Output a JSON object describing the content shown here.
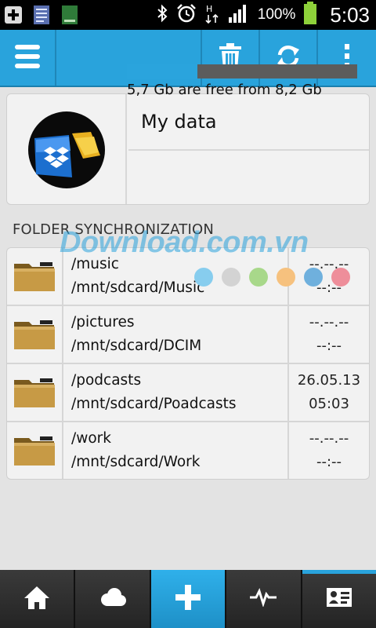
{
  "status_bar": {
    "battery_percent": "100%",
    "time": "5:03",
    "icons": [
      "add-icon",
      "document-icon",
      "book-icon",
      "bluetooth-icon",
      "alarm-icon",
      "hspa-signal-icon",
      "cell-signal-icon",
      "battery-icon"
    ]
  },
  "action_bar": {
    "buttons": [
      "menu-icon",
      "trash-icon",
      "refresh-icon",
      "overflow-icon"
    ],
    "accent_color": "#29a3dc"
  },
  "account": {
    "name": "My data",
    "storage_text": "5,7 Gb are free from 8,2 Gb",
    "used_fraction": 0.305,
    "service_icon": "dropbox-icon"
  },
  "section": {
    "title": "FOLDER SYNCHRONIZATION"
  },
  "folders": [
    {
      "name": "/music",
      "path": "/mnt/sdcard/Music",
      "date": "--.--.--",
      "time": "--:--"
    },
    {
      "name": "/pictures",
      "path": "/mnt/sdcard/DCIM",
      "date": "--.--.--",
      "time": "--:--"
    },
    {
      "name": "/podcasts",
      "path": "/mnt/sdcard/Poadcasts",
      "date": "26.05.13",
      "time": "05:03"
    },
    {
      "name": "/work",
      "path": "/mnt/sdcard/Work",
      "date": "--.--.--",
      "time": "--:--"
    }
  ],
  "watermark": {
    "text": "Download.com.vn",
    "dot_colors": [
      "#87cdee",
      "#d3d3d3",
      "#a8d88a",
      "#f6c17e",
      "#6fb0dd",
      "#ee8e9a"
    ]
  },
  "bottom_bar": {
    "items": [
      "home-icon",
      "cloud-icon",
      "add-icon",
      "activity-icon",
      "contact-card-icon"
    ],
    "active_index": 2
  }
}
